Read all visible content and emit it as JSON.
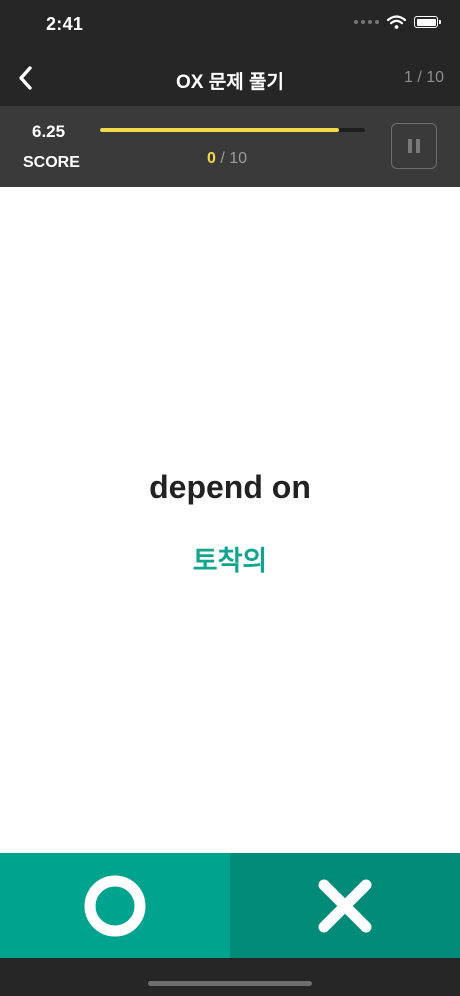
{
  "status_bar": {
    "time": "2:41",
    "icons": [
      "signal-dots-icon",
      "wifi-icon",
      "battery-icon"
    ]
  },
  "nav": {
    "back_icon": "chevron-left-icon",
    "title": "OX 문제 풀기",
    "progress": "1 / 10"
  },
  "score": {
    "value": "6.25",
    "label": "SCORE",
    "time_remaining_fraction": 0.9,
    "correct": "0",
    "total_suffix": " / 10",
    "pause_icon": "pause-icon"
  },
  "question": {
    "word": "depend on",
    "meaning": "토착의"
  },
  "answers": {
    "o_icon": "circle-o-icon",
    "x_icon": "cross-x-icon"
  },
  "colors": {
    "dark_bar": "#262626",
    "score_panel": "#3a3a3a",
    "accent_yellow": "#f2da4a",
    "meaning_teal": "#13a48e",
    "o_button": "#00a48e",
    "x_button": "#008a78"
  }
}
